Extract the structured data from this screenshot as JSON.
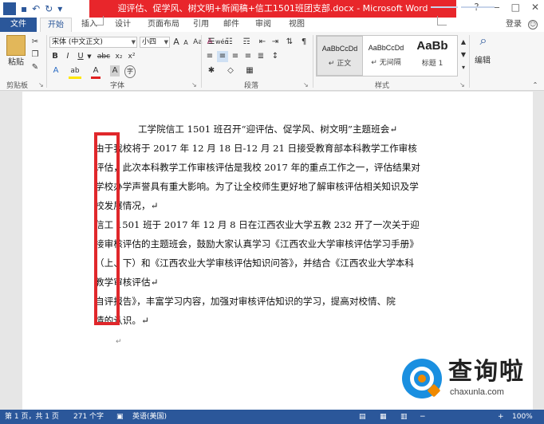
{
  "titlebar": {
    "title": "迎评估、促学风、树文明+新闻稿+信工1501班团支部.docx - Microsoft Word",
    "app_icon": "W",
    "qat_icons": [
      "save-icon",
      "undo-icon",
      "redo-icon",
      "customize-icon"
    ],
    "window_buttons": [
      "?",
      "—",
      "□",
      "✕"
    ]
  },
  "tabs": [
    {
      "label": "文件"
    },
    {
      "label": "开始"
    },
    {
      "label": "插入"
    },
    {
      "label": "设计"
    },
    {
      "label": "页面布局"
    },
    {
      "label": "引用"
    },
    {
      "label": "邮件"
    },
    {
      "label": "审阅"
    },
    {
      "label": "视图"
    }
  ],
  "login_label": "登录",
  "ribbon": {
    "clipboard": {
      "paste_label": "粘贴",
      "group_label": "剪贴板"
    },
    "font": {
      "font_name": "宋体 (中文正文)",
      "font_size": "小四",
      "group_label": "字体",
      "size_up": "A",
      "size_down": "A",
      "aa": "Aa",
      "clear": "A",
      "wen": "wén",
      "bold": "B",
      "italic": "I",
      "underline": "U",
      "strike": "abc",
      "sub": "x₂",
      "sup": "x²",
      "texteffect": "A",
      "highlight": "ab",
      "fontcolor": "A",
      "charshade": "A",
      "enclose": "字"
    },
    "paragraph": {
      "group_label": "段落"
    },
    "styles": {
      "group_label": "样式",
      "items": [
        {
          "sample": "AaBbCcDd",
          "name": "↵ 正文"
        },
        {
          "sample": "AaBbCcDd",
          "name": "↵ 无间隔"
        },
        {
          "sample": "AaBb",
          "name": "标题 1"
        }
      ]
    },
    "editing": {
      "label": "编辑"
    }
  },
  "document": {
    "lines": [
      "工学院信工 1501 班召开“迎评估、促学风、树文明”主题班会↵",
      "由于我校将于 2017 年 12 月 18 日-12 月 21 日接受教育部本科教学工作审核",
      "评估，此次本科教学工作审核评估是我校 2017 年的重点工作之一，评估结果对",
      "学校办学声誉具有重大影响。为了让全校师生更好地了解审核评估相关知识及学",
      "校发展情况，↵",
      "信工 1501 班于 2017 年 12 月 8 日在江西农业大学五教 232 开了一次关于迎",
      "接审核评估的主题班会，鼓励大家认真学习《江西农业大学审核评估学习手册》",
      "（上、下）和《江西农业大学审核评估知识问答》，并结合《江西农业大学本科",
      "教学审核评估↵",
      "自评报告》，丰富学习内容，加强对审核评估知识的学习，提高对校情、院",
      "情的认识。↵"
    ],
    "end_mark": "↵"
  },
  "watermark": {
    "title": "查询啦",
    "site": "chaxunla.com"
  },
  "statusbar": {
    "page": "第 1 页，共 1 页",
    "words": "271 个字",
    "language": "英语(美国)",
    "zoom_level": "100%",
    "zoom_fraction": 0.45
  },
  "colors": {
    "accent": "#2b579a",
    "title_bar": "#e8262b",
    "highlight_box": "#e0272b"
  }
}
